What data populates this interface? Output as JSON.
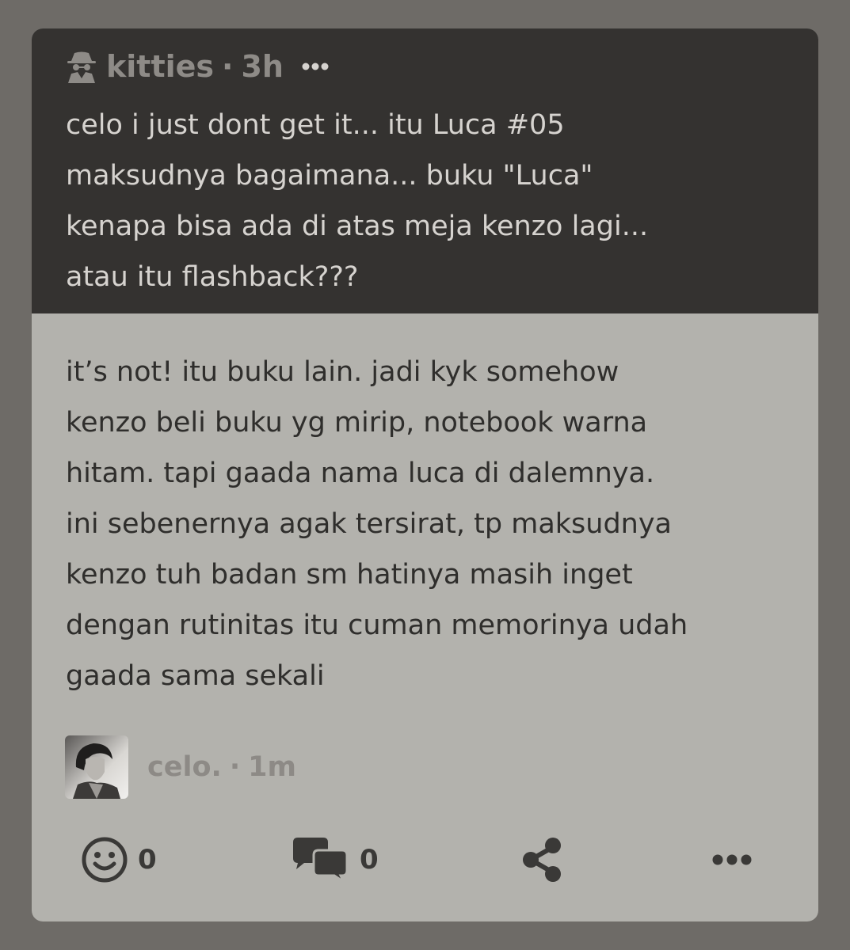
{
  "question": {
    "author": "kitties",
    "separator": "·",
    "time": "3h",
    "author_icon": "spy-icon",
    "more_icon": "more-horizontal-icon",
    "text": "celo i just dont get it... itu Luca #05\nmaksudnya bagaimana... buku \"Luca\"\nkenapa bisa ada di atas meja kenzo lagi...\natau itu flashback???"
  },
  "answer": {
    "text": "it’s not! itu buku lain. jadi kyk somehow\nkenzo beli buku yg mirip, notebook warna\nhitam. tapi gaada nama luca di dalemnya.\nini sebenernya agak tersirat, tp maksudnya\nkenzo tuh badan sm hatinya masih inget\ndengan rutinitas itu cuman memorinya udah\ngaada sama sekali",
    "author": "celo.",
    "separator": "·",
    "time": "1m"
  },
  "actions": {
    "like_icon": "smiley-icon",
    "like_count": "0",
    "comment_icon": "speech-bubbles-icon",
    "comment_count": "0",
    "share_icon": "share-icon",
    "more_icon": "more-horizontal-icon"
  },
  "colors": {
    "page_background": "#6e6b67",
    "question_background": "#343230",
    "answer_background": "#b3b2ad"
  }
}
